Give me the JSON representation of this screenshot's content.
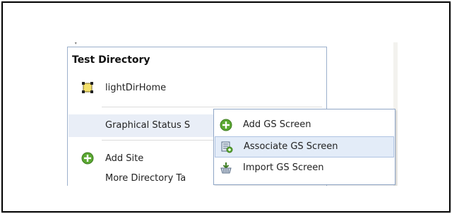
{
  "menu": {
    "title": "Test Directory",
    "items": [
      {
        "label": "lightDirHome",
        "icon": "directory-box-icon"
      },
      {
        "label": "Graphical Status S",
        "icon": "none",
        "selected": true
      },
      {
        "label": "Add Site",
        "icon": "plus-circle-icon"
      },
      {
        "label": "More Directory Ta",
        "icon": "none"
      }
    ]
  },
  "submenu": {
    "items": [
      {
        "label": "Add GS Screen",
        "icon": "plus-circle-icon"
      },
      {
        "label": "Associate GS Screen",
        "icon": "associate-screen-icon",
        "highlighted": true
      },
      {
        "label": "Import GS Screen",
        "icon": "import-basket-icon"
      }
    ]
  },
  "colors": {
    "border": "#9cb0cc",
    "highlight": "#e3ecf8",
    "plus_green": "#5ba832"
  }
}
